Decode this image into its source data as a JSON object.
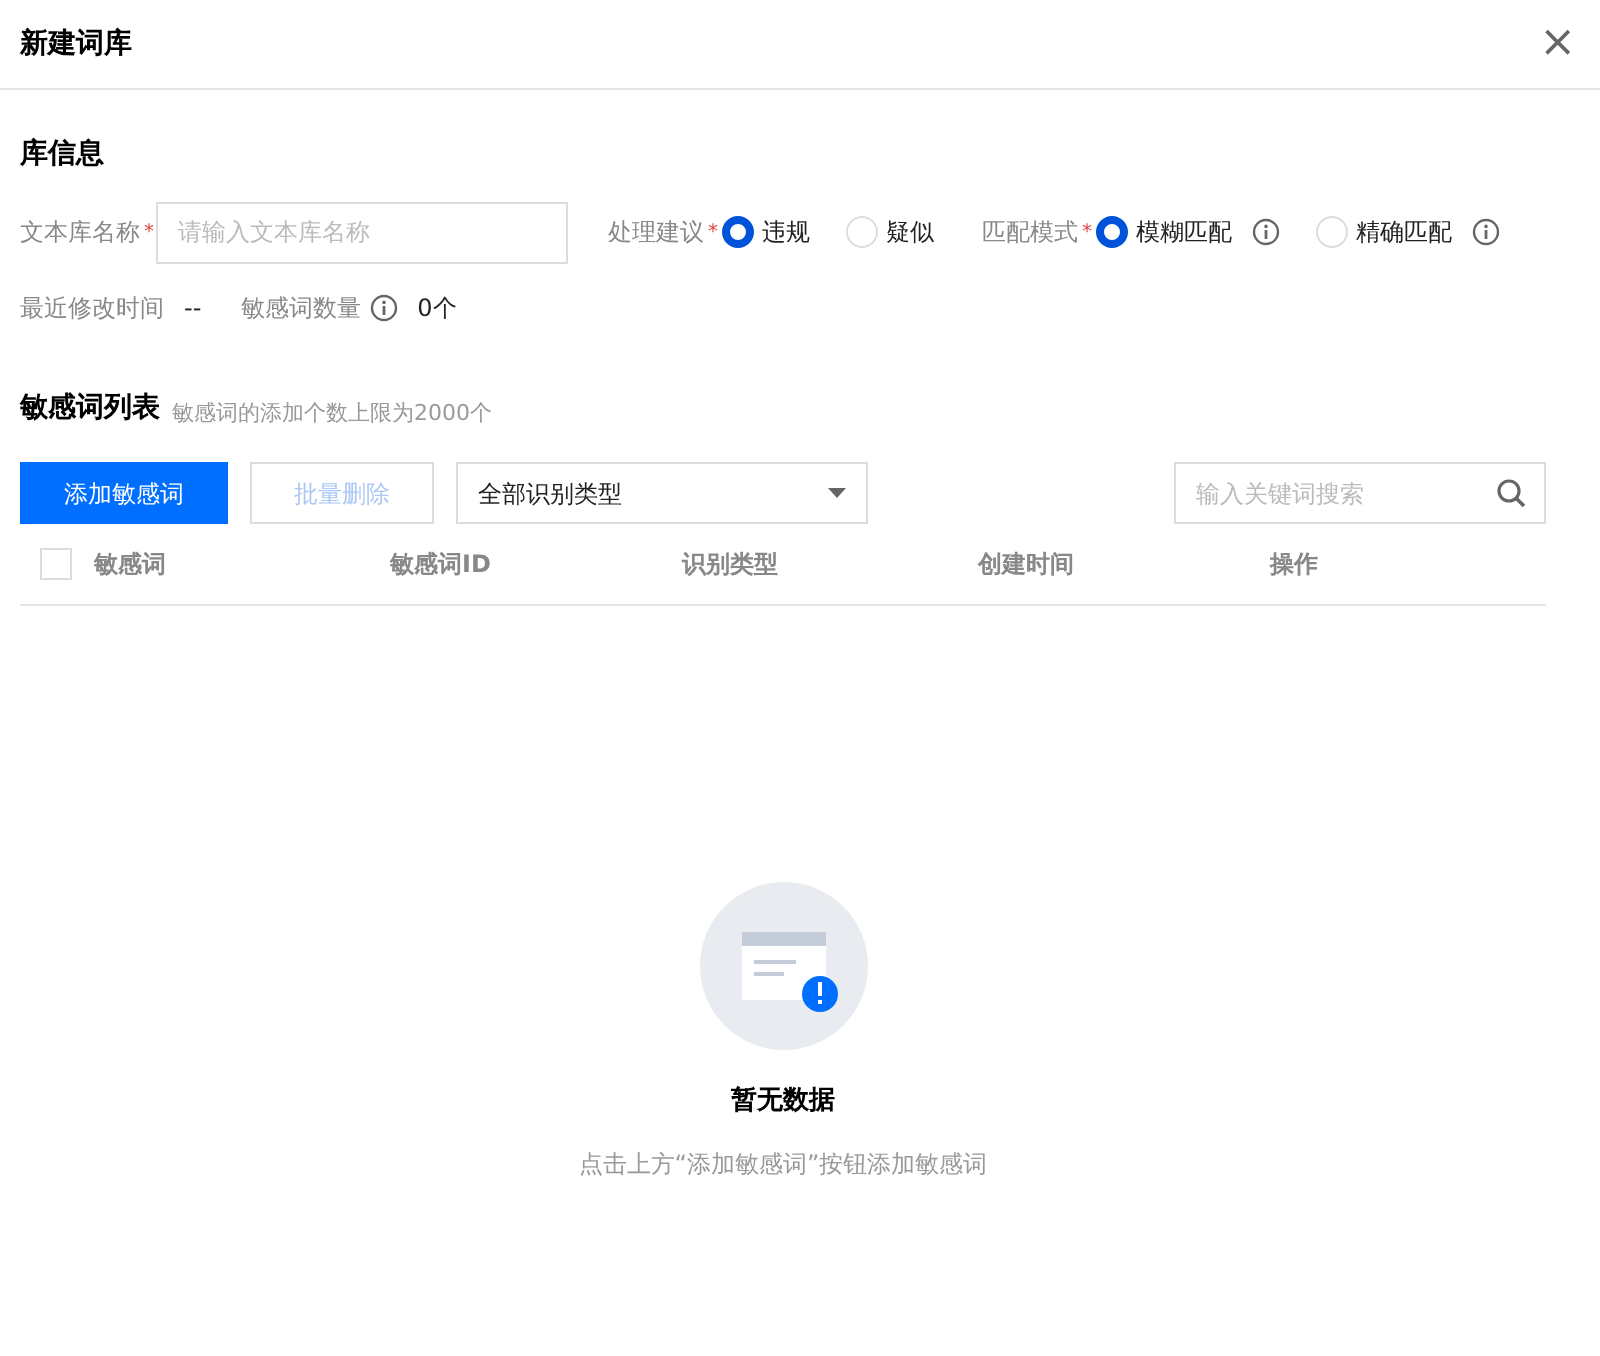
{
  "dialog": {
    "title": "新建词库",
    "close": "×"
  },
  "info_section": {
    "title": "库信息",
    "name_field": {
      "label": "文本库名称",
      "required": "*",
      "placeholder": "请输入文本库名称"
    },
    "radio_groups": [
      {
        "label": "处理建议",
        "required": "*",
        "options": [
          {
            "label": "违规",
            "selected": true,
            "info": false
          },
          {
            "label": "疑似",
            "selected": false,
            "info": false
          }
        ]
      },
      {
        "label": "匹配模式",
        "required": "*",
        "options": [
          {
            "label": "模糊匹配",
            "selected": true,
            "info": true
          },
          {
            "label": "精确匹配",
            "selected": false,
            "info": true
          }
        ]
      }
    ],
    "meta": [
      {
        "label": "最近修改时间",
        "value": "--",
        "info": false
      },
      {
        "label": "敏感词数量",
        "value": "0个",
        "info": true
      }
    ]
  },
  "list_section": {
    "title": "敏感词列表",
    "hint": "敏感词的添加个数上限为2000个",
    "add_button": "添加敏感词",
    "delete_button": {
      "label": "批量删除",
      "disabled": true
    },
    "type_filter": "全部识别类型",
    "search": {
      "placeholder": "输入关键词搜索"
    },
    "table": {
      "select_all": {
        "checked": false
      },
      "columns": [
        "敏感词",
        "敏感词ID",
        "识别类型",
        "创建时间",
        "操作"
      ]
    },
    "empty": {
      "title": "暂无数据",
      "description": "点击上方“添加敏感词”按钮添加敏感词"
    }
  }
}
